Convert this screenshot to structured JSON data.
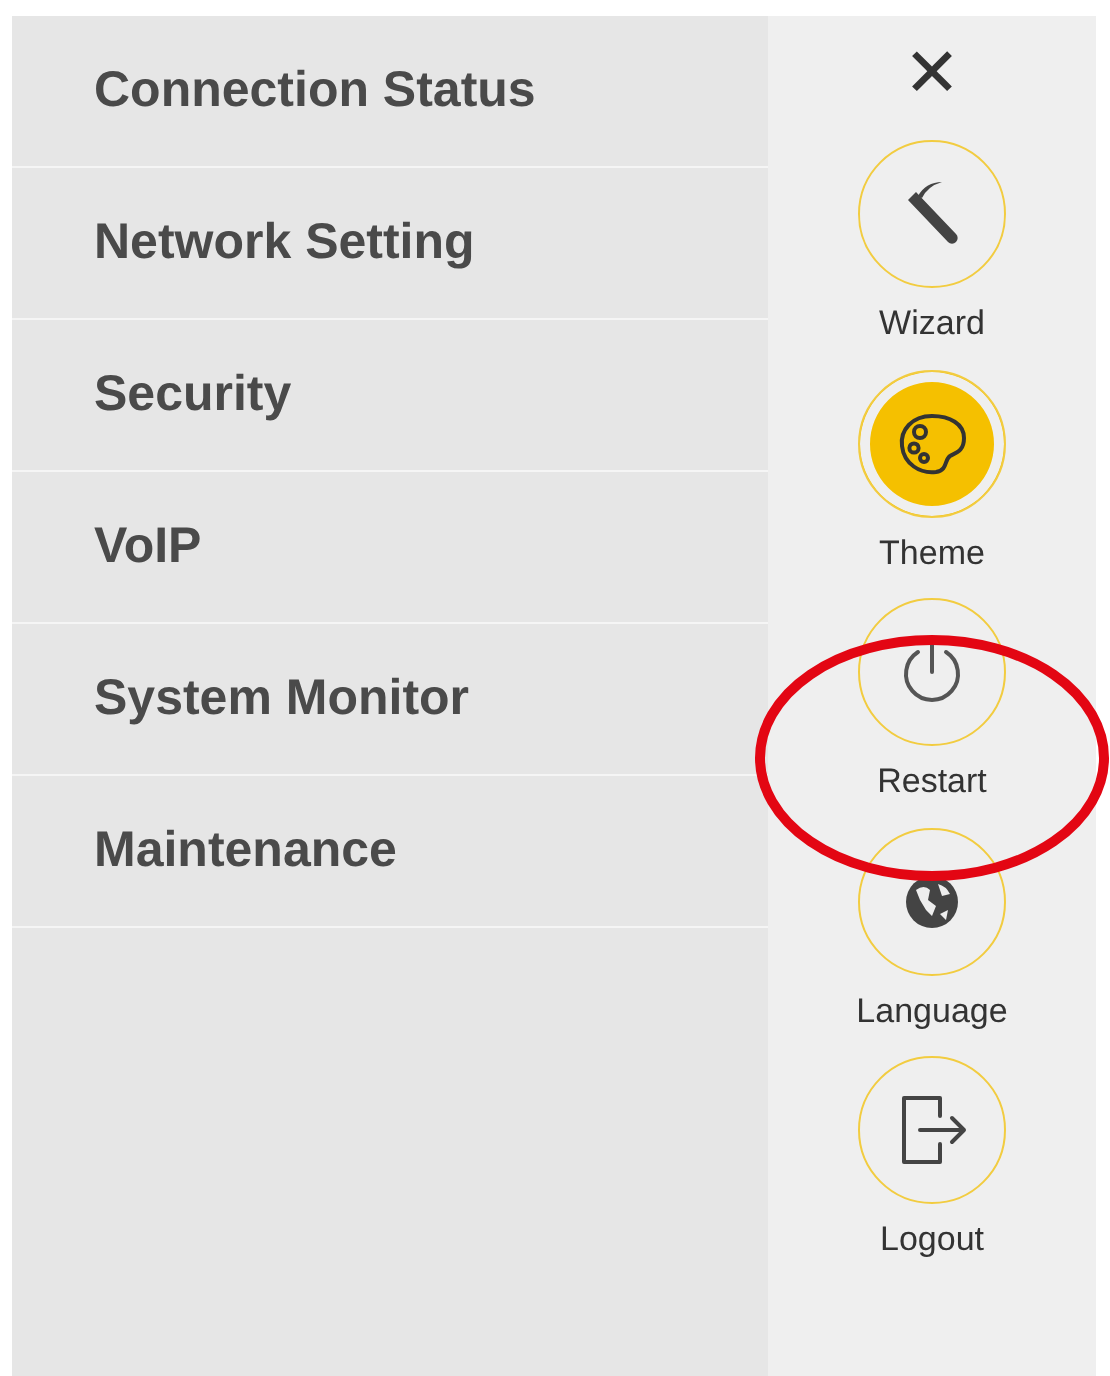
{
  "menu": [
    {
      "label": "Connection Status"
    },
    {
      "label": "Network Setting"
    },
    {
      "label": "Security"
    },
    {
      "label": "VoIP"
    },
    {
      "label": "System Monitor"
    },
    {
      "label": "Maintenance"
    }
  ],
  "close_button": {
    "label": "✕"
  },
  "actions": [
    {
      "kind": "wizard",
      "label": "Wizard",
      "selected": false
    },
    {
      "kind": "theme",
      "label": "Theme",
      "selected": true
    },
    {
      "kind": "restart",
      "label": "Restart",
      "selected": false
    },
    {
      "kind": "language",
      "label": "Language",
      "selected": false
    },
    {
      "kind": "logout",
      "label": "Logout",
      "selected": false
    }
  ],
  "annotation": {
    "kind": "ellipse",
    "color": "#e30613"
  }
}
